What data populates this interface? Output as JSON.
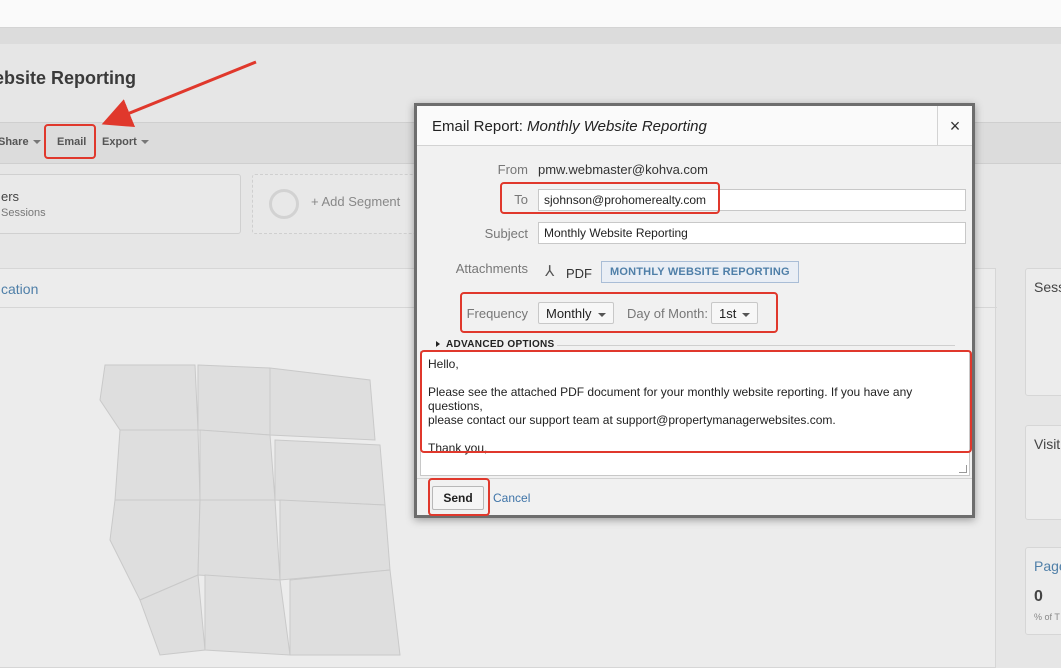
{
  "page": {
    "title": "ebsite Reporting",
    "toolbar": {
      "share_label": "Share",
      "email_label": "Email",
      "export_label": "Export"
    },
    "segment": {
      "name": "ers",
      "sub": "Sessions"
    },
    "add_segment_label": "+ Add Segment",
    "card_title": "cation",
    "side_cards": [
      {
        "title": "Sess"
      },
      {
        "title": "Visit"
      },
      {
        "title": "Page",
        "value": "0",
        "sub": "% of T"
      }
    ]
  },
  "modal": {
    "title_prefix": "Email Report:",
    "title_report": "Monthly Website Reporting",
    "close_glyph": "×",
    "from_label": "From",
    "from_value": "pmw.webmaster@kohva.com",
    "to_label": "To",
    "to_value": "sjohnson@prohomerealty.com",
    "subject_label": "Subject",
    "subject_value": "Monthly Website Reporting",
    "attachments_label": "Attachments",
    "attachment_type": "PDF",
    "attachment_name": "MONTHLY WEBSITE REPORTING",
    "frequency_label": "Frequency",
    "frequency_value": "Monthly",
    "day_label": "Day of Month:",
    "day_value": "1st",
    "advanced_label": "ADVANCED OPTIONS",
    "message": {
      "greeting": "Hello,",
      "line1": "Please see the attached PDF document for your monthly website reporting.  If you have any questions,",
      "line2": "please contact our support team at support@propertymanagerwebsites.com.",
      "closing": "Thank you,"
    },
    "send_label": "Send",
    "cancel_label": "Cancel"
  },
  "colors": {
    "highlight": "#e0382c",
    "link": "#3f74a8",
    "attachment_button": "#4f7fa8"
  },
  "icons": {
    "pdf": "pdf-icon",
    "close": "close-icon",
    "caret": "caret-down-icon",
    "arrow": "red-arrow-annotation"
  }
}
